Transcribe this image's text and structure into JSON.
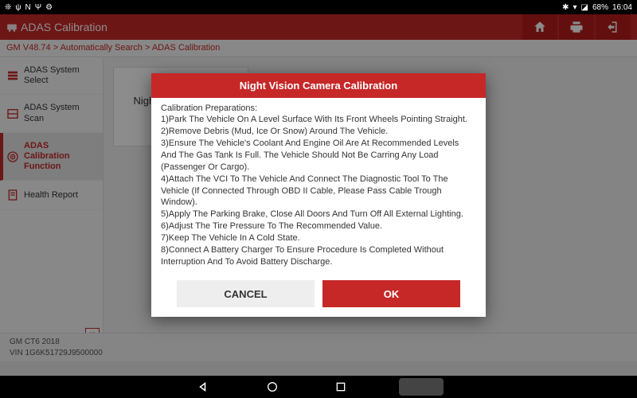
{
  "statusbar": {
    "battery": "68%",
    "time": "16:04"
  },
  "appbar": {
    "title": "ADAS Calibration"
  },
  "breadcrumb": "GM V48.74 > Automatically Search > ADAS Calibration",
  "sidebar": {
    "items": [
      {
        "label": "ADAS System Select"
      },
      {
        "label": "ADAS System Scan"
      },
      {
        "label": "ADAS Calibration Function"
      },
      {
        "label": "Health Report"
      }
    ],
    "collapse": "K"
  },
  "card": {
    "title": "Night Vision Camera Calibration"
  },
  "footer": {
    "line1": "GM CT6 2018",
    "line2": "VIN 1G6K51729J9500000"
  },
  "dialog": {
    "title": "Night Vision Camera Calibration",
    "heading": "Calibration Preparations:",
    "lines": [
      "1)Park The Vehicle On A Level Surface With Its Front Wheels Pointing Straight.",
      "2)Remove Debris (Mud, Ice Or Snow) Around The Vehicle.",
      "3)Ensure The Vehicle's Coolant And Engine Oil Are At Recommended Levels And The Gas Tank Is Full. The Vehicle Should Not Be Carring Any Load (Passenger Or Cargo).",
      "4)Attach The VCI To The Vehicle And Connect The Diagnostic Tool To The Vehicle (If Connected Through OBD II Cable, Please Pass Cable Trough Window).",
      "5)Apply The Parking Brake, Close All Doors And Turn Off All External Lighting.",
      "6)Adjust The Tire Pressure To The Recommended Value.",
      "7)Keep The Vehicle In A Cold State.",
      "8)Connect A Battery Charger To Ensure Procedure Is Completed Without Interruption And To Avoid Battery Discharge."
    ],
    "cancel": "CANCEL",
    "ok": "OK"
  }
}
